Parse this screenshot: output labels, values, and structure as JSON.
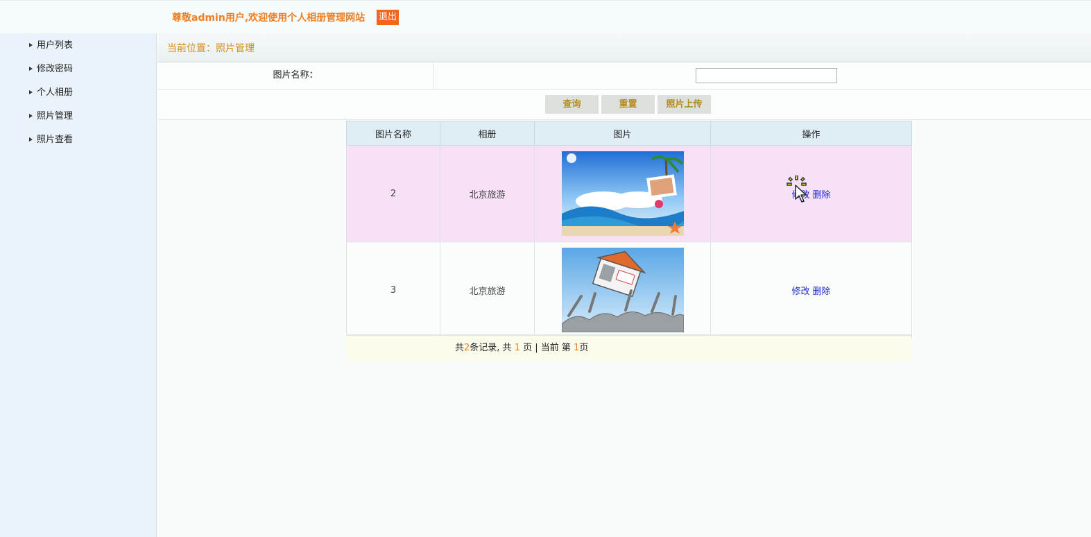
{
  "header": {
    "welcome_text": "尊敬admin用户,欢迎使用个人相册管理网站",
    "logout_label": "退出"
  },
  "sidebar": {
    "items": [
      {
        "label": "用户列表"
      },
      {
        "label": "修改密码"
      },
      {
        "label": "个人相册"
      },
      {
        "label": "照片管理"
      },
      {
        "label": "照片查看"
      }
    ]
  },
  "breadcrumb": {
    "text": "当前位置：照片管理"
  },
  "search": {
    "label": "图片名称：",
    "value": "",
    "placeholder": ""
  },
  "buttons": {
    "query": "查询",
    "reset": "重置",
    "upload": "照片上传"
  },
  "table": {
    "headers": [
      "图片名称",
      "相册",
      "图片",
      "操作"
    ],
    "rows": [
      {
        "name": "2",
        "album": "北京旅游",
        "image": "beach-holiday-photo",
        "edit": "修改",
        "delete": "删除"
      },
      {
        "name": "3",
        "album": "北京旅游",
        "image": "cartoon-house-cheering-crowd",
        "edit": "修改",
        "delete": "删除"
      }
    ]
  },
  "pager": {
    "prefix": "共",
    "total_records": "2",
    "records_suffix": "条记录, 共 ",
    "total_pages": "1",
    "pages_suffix": " 页 | 当前 第 ",
    "current_page": "1",
    "current_suffix": "页"
  },
  "colors": {
    "accent_orange": "#ee7f24",
    "logout_bg": "#f5651c",
    "link_blue": "#1f2bd5",
    "row_highlight": "#f7e1f6"
  }
}
